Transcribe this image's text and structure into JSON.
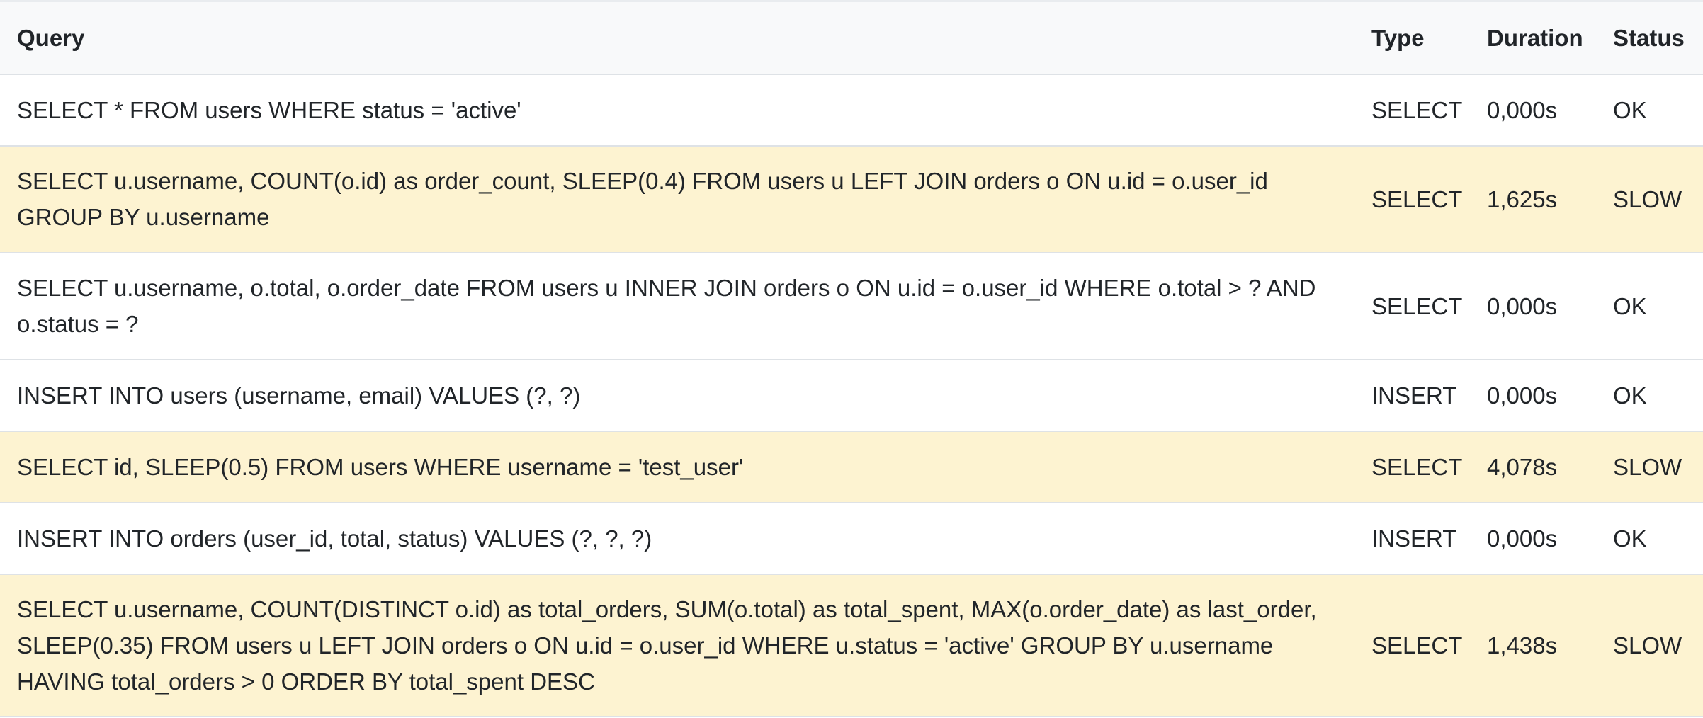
{
  "table": {
    "headers": {
      "query": "Query",
      "type": "Type",
      "duration": "Duration",
      "status": "Status"
    },
    "rows": [
      {
        "query": "SELECT * FROM users WHERE status = 'active'",
        "type": "SELECT",
        "duration": "0,000s",
        "status": "OK"
      },
      {
        "query": "SELECT u.username, COUNT(o.id) as order_count, SLEEP(0.4) FROM users u LEFT JOIN orders o ON u.id = o.user_id GROUP BY u.username",
        "type": "SELECT",
        "duration": "1,625s",
        "status": "SLOW"
      },
      {
        "query": "SELECT u.username, o.total, o.order_date FROM users u INNER JOIN orders o ON u.id = o.user_id WHERE o.total > ? AND o.status = ?",
        "type": "SELECT",
        "duration": "0,000s",
        "status": "OK"
      },
      {
        "query": "INSERT INTO users (username, email) VALUES (?, ?)",
        "type": "INSERT",
        "duration": "0,000s",
        "status": "OK"
      },
      {
        "query": "SELECT id, SLEEP(0.5) FROM users WHERE username = 'test_user'",
        "type": "SELECT",
        "duration": "4,078s",
        "status": "SLOW"
      },
      {
        "query": "INSERT INTO orders (user_id, total, status) VALUES (?, ?, ?)",
        "type": "INSERT",
        "duration": "0,000s",
        "status": "OK"
      },
      {
        "query": "SELECT u.username, COUNT(DISTINCT o.id) as total_orders, SUM(o.total) as total_spent, MAX(o.order_date) as last_order, SLEEP(0.35) FROM users u LEFT JOIN orders o ON u.id = o.user_id WHERE u.status = 'active' GROUP BY u.username HAVING total_orders > 0 ORDER BY total_spent DESC",
        "type": "SELECT",
        "duration": "1,438s",
        "status": "SLOW"
      }
    ]
  },
  "colors": {
    "header_background": "#f8f9fa",
    "slow_row_background": "#fdf3d1",
    "ok_row_background": "#ffffff",
    "border": "#dee2e6",
    "text": "#212529"
  }
}
